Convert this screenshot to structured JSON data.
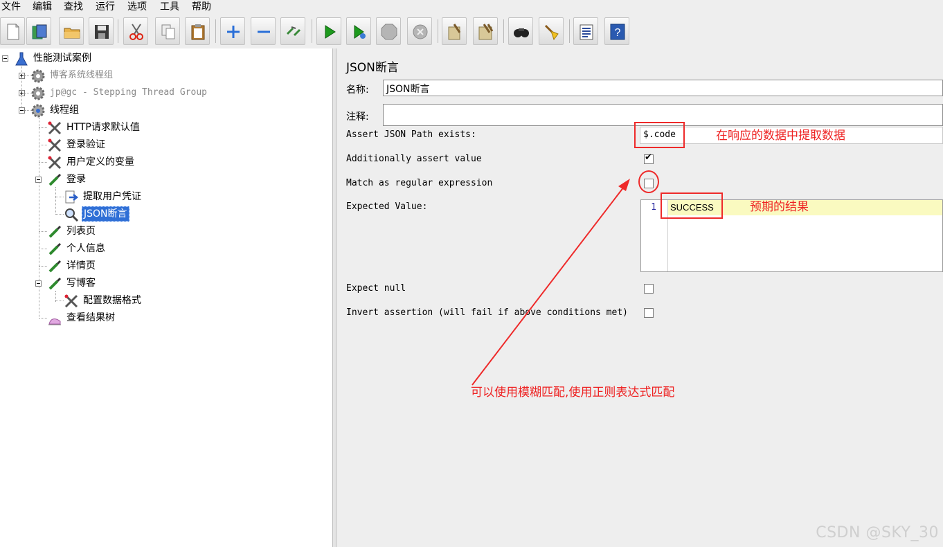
{
  "menu": [
    "文件",
    "编辑",
    "查找",
    "运行",
    "选项",
    "工具",
    "帮助"
  ],
  "toolbar": {
    "buttons": [
      "new-icon",
      "templates-icon",
      "open-icon",
      "save-icon",
      "cut-icon",
      "copy-icon",
      "paste-icon",
      "expand-icon",
      "collapse-icon",
      "toggle-icon",
      "start-icon",
      "start-no-pause-icon",
      "stop-icon",
      "shutdown-icon",
      "clear-icon",
      "clear-all-icon",
      "search-icon",
      "reset-search-icon",
      "function-helper-icon",
      "help-icon"
    ]
  },
  "tree": {
    "root": "性能测试案例",
    "group1": "博客系统线程组",
    "group2": "jp@gc - Stepping Thread Group",
    "group3": "线程组",
    "http_defaults": "HTTP请求默认值",
    "login_verify": "登录验证",
    "user_vars": "用户定义的变量",
    "login": "登录",
    "extract_cred": "提取用户凭证",
    "json_assert": "JSON断言",
    "list_page": "列表页",
    "personal_info": "个人信息",
    "detail_page": "详情页",
    "write_blog": "写博客",
    "config_format": "配置数据格式",
    "view_results": "查看结果树"
  },
  "panel": {
    "title": "JSON断言",
    "name_label": "名称:",
    "name_value": "JSON断言",
    "comment_label": "注释:",
    "comment_value": "",
    "path_label": "Assert JSON Path exists:",
    "path_value": "$.code",
    "additionally_label": "Additionally assert value",
    "additionally_checked": true,
    "regex_label": "Match as regular expression",
    "regex_checked": false,
    "expected_label": "Expected Value:",
    "expected_line_no": "1",
    "expected_value": "SUCCESS",
    "expect_null_label": "Expect null",
    "expect_null_checked": false,
    "invert_label": "Invert assertion (will fail if above conditions met)",
    "invert_checked": false
  },
  "annotations": {
    "extract": "在响应的数据中提取数据",
    "expected": "预期的结果",
    "fuzzy": "可以使用模糊匹配,使用正则表达式匹配",
    "color": "#ee2222"
  },
  "watermark": "CSDN @SKY_30"
}
